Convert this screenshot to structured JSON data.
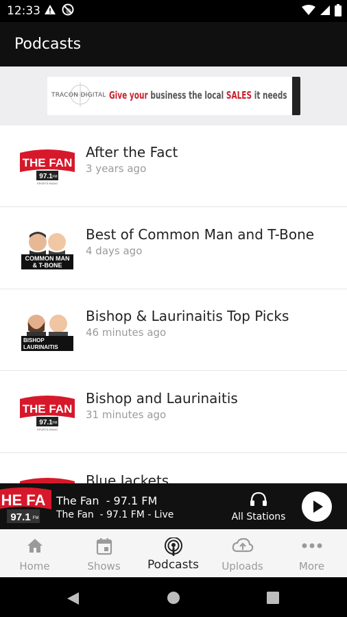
{
  "status_bar": {
    "time": "12:33"
  },
  "app_bar": {
    "title": "Podcasts"
  },
  "banner": {
    "brand": "TRACON DIGITAL",
    "text_give": "Give your",
    "text_mid": " business the local ",
    "text_sales": "SALES",
    "text_end": " it needs"
  },
  "podcasts": [
    {
      "title": "After the Fact",
      "updated": "3 years ago",
      "logo": "the-fan-logo"
    },
    {
      "title": "Best of Common Man and T-Bone",
      "updated": "4 days ago",
      "logo": "common-man-tbone-logo"
    },
    {
      "title": "Bishop & Laurinaitis Top Picks",
      "updated": "46 minutes ago",
      "logo": "bishop-laurinaitis-logo"
    },
    {
      "title": "Bishop and Laurinaitis",
      "updated": "31 minutes ago",
      "logo": "the-fan-logo"
    },
    {
      "title": "Blue Jackets",
      "updated": "",
      "logo": "the-fan-logo"
    }
  ],
  "logos": {
    "the_fan": {
      "name": "THE FAN",
      "freq": "97.1",
      "fm": "FM",
      "tag": "SPORTS RADIO"
    },
    "common_man": {
      "line1": "COMMON MAN",
      "line2": "& T-BONE"
    },
    "bishop": {
      "line1": "BISHOP",
      "line2": "LAURINAITIS"
    },
    "player": {
      "name": "HE FA",
      "freq": "97.1",
      "fm": "FM"
    }
  },
  "player": {
    "station": "The Fan  - 97.1 FM",
    "status": "The Fan  - 97.1 FM - Live",
    "all_stations": "All Stations"
  },
  "bottom_nav": [
    {
      "label": "Home",
      "icon": "home-icon"
    },
    {
      "label": "Shows",
      "icon": "calendar-icon"
    },
    {
      "label": "Podcasts",
      "icon": "podcast-icon",
      "active": true
    },
    {
      "label": "Uploads",
      "icon": "cloud-upload-icon"
    },
    {
      "label": "More",
      "icon": "more-icon"
    }
  ],
  "colors": {
    "brand_red": "#d7182a",
    "app_bar": "#101010",
    "player_bg": "#111111"
  }
}
